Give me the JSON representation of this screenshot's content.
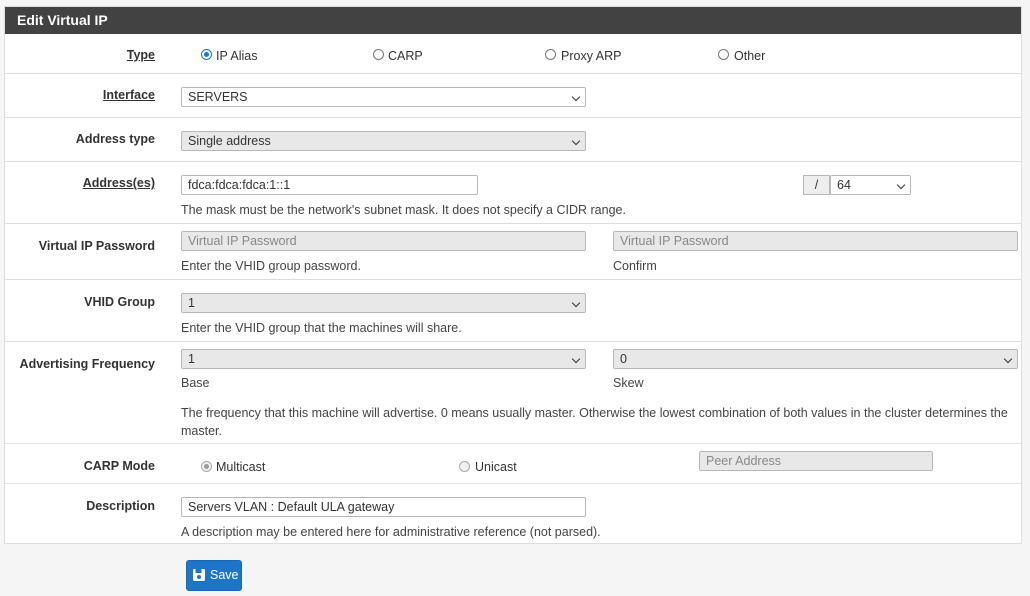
{
  "panel": {
    "title": "Edit Virtual IP"
  },
  "type_row": {
    "label": "Type",
    "options": [
      {
        "label": "IP Alias",
        "selected": true
      },
      {
        "label": "CARP",
        "selected": false
      },
      {
        "label": "Proxy ARP",
        "selected": false
      },
      {
        "label": "Other",
        "selected": false
      }
    ]
  },
  "interface_row": {
    "label": "Interface",
    "value": "SERVERS"
  },
  "address_type_row": {
    "label": "Address type",
    "value": "Single address"
  },
  "address_row": {
    "label": "Address(es)",
    "value": "fdca:fdca:fdca:1::1",
    "slash": "/",
    "mask": "64",
    "help": "The mask must be the network's subnet mask. It does not specify a CIDR range."
  },
  "vip_password_row": {
    "label": "Virtual IP Password",
    "placeholder": "Virtual IP Password",
    "confirm_placeholder": "Virtual IP Password",
    "help": "Enter the VHID group password.",
    "confirm_help": "Confirm"
  },
  "vhid_row": {
    "label": "VHID Group",
    "value": "1",
    "help": "Enter the VHID group that the machines will share."
  },
  "adv_freq_row": {
    "label": "Advertising Frequency",
    "base_value": "1",
    "skew_value": "0",
    "base_label": "Base",
    "skew_label": "Skew",
    "help": "The frequency that this machine will advertise. 0 means usually master. Otherwise the lowest combination of both values in the cluster determines the master."
  },
  "carp_mode_row": {
    "label": "CARP Mode",
    "multicast": "Multicast",
    "unicast": "Unicast",
    "peer_placeholder": "Peer Address"
  },
  "description_row": {
    "label": "Description",
    "value": "Servers VLAN : Default ULA gateway",
    "help": "A description may be entered here for administrative reference (not parsed)."
  },
  "save_button": {
    "label": "Save"
  },
  "colors": {
    "header": "#424242",
    "accent": "#1e74c9",
    "disabled": "#e8e8e8"
  }
}
